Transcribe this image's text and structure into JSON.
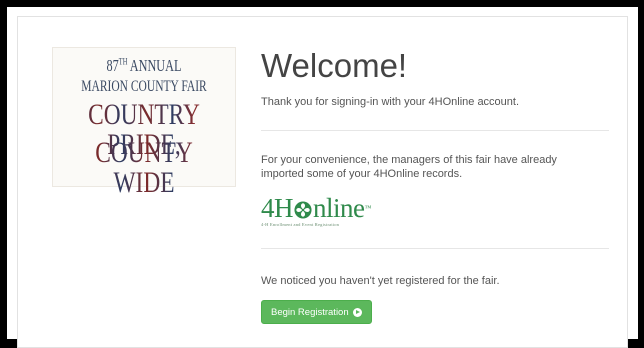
{
  "logo": {
    "line1_number": "87",
    "line1_suffix": "TH",
    "line1_rest": " ANNUAL",
    "line2": "MARION COUNTY FAIR",
    "line3": "COUNTRY PRIDE,",
    "line4": "COUNTY WIDE"
  },
  "main": {
    "title": "Welcome!",
    "signin_text": "Thank you for signing-in with your 4HOnline account.",
    "import_text": "For your convenience, the managers of this fair have already imported some of your 4HOnline records.",
    "brand": {
      "part1": "4H",
      "part2": "nline",
      "trademark": "™",
      "tagline": "4-H Enrollment and Event Registration",
      "icon": "clover-icon"
    },
    "register_text": "We noticed you haven't yet registered for the fair.",
    "button_label": "Begin Registration"
  },
  "colors": {
    "button_green": "#5cb85c",
    "brand_green": "#2f8a4b"
  }
}
